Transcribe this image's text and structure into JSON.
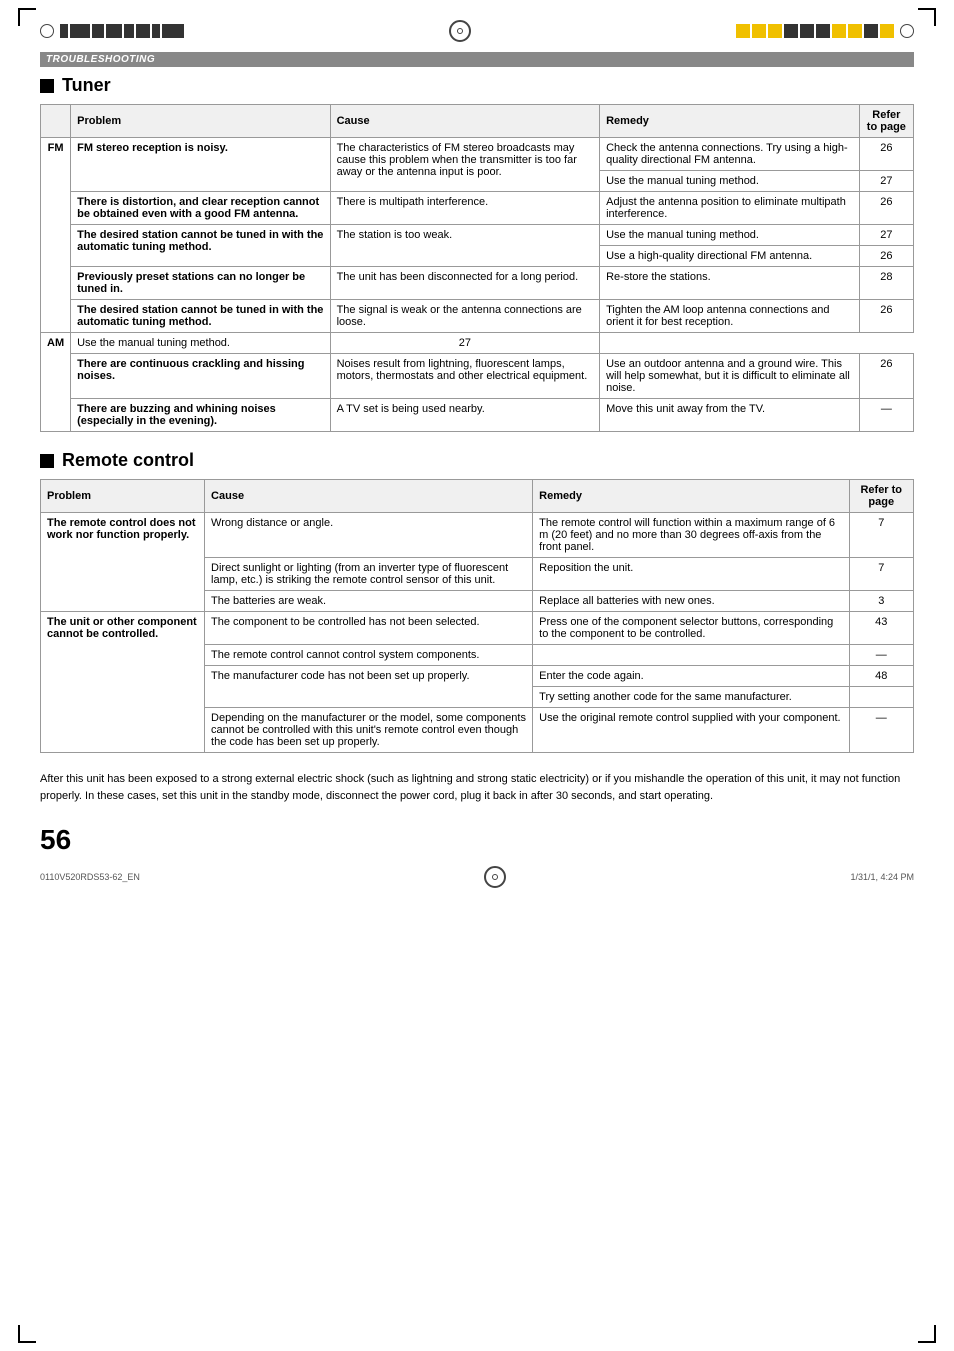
{
  "page": {
    "section_header": "TROUBLESHOOTING",
    "tuner_title": "Tuner",
    "remote_title": "Remote control",
    "page_number": "56",
    "footer_code": "0110V520RDS53-62_EN",
    "footer_page": "56",
    "footer_date": "1/31/1, 4:24 PM"
  },
  "tuner_table": {
    "headers": [
      "Problem",
      "Cause",
      "Remedy",
      "Refer to page"
    ],
    "fm_label": "FM",
    "am_label": "AM",
    "rows": [
      {
        "problem": "FM stereo reception is noisy.",
        "causes": [
          "The characteristics of FM stereo broadcasts may cause this problem when the transmitter is too far away or the antenna input is poor."
        ],
        "remedies": [
          "Check the antenna connections. Try using a high-quality directional FM antenna.",
          "Use the manual tuning method."
        ],
        "refer": [
          "26",
          "27"
        ]
      },
      {
        "problem": "There is distortion, and clear reception cannot be obtained even with a good FM antenna.",
        "causes": [
          "There is multipath interference."
        ],
        "remedies": [
          "Adjust the antenna position to eliminate multipath interference."
        ],
        "refer": [
          "26"
        ]
      },
      {
        "problem": "The desired station cannot be tuned in with the automatic tuning method.",
        "causes": [
          "The station is too weak."
        ],
        "remedies": [
          "Use the manual tuning method.",
          "Use a high-quality directional FM antenna."
        ],
        "refer": [
          "27",
          "26"
        ]
      },
      {
        "problem": "Previously preset stations can no longer be tuned in.",
        "causes": [
          "The unit has been disconnected for a long period."
        ],
        "remedies": [
          "Re-store the stations."
        ],
        "refer": [
          "28"
        ]
      },
      {
        "problem": "The desired station cannot be tuned in with the automatic tuning method.",
        "causes": [
          "The signal is weak or the antenna connections are loose."
        ],
        "remedies": [
          "Tighten the AM loop antenna connections and orient it for best reception.",
          "Use the manual tuning method."
        ],
        "refer": [
          "26",
          "27"
        ],
        "am": true
      },
      {
        "problem": "There are continuous crackling and hissing noises.",
        "causes": [
          "Noises result from lightning, fluorescent lamps, motors, thermostats and other electrical equipment."
        ],
        "remedies": [
          "Use an outdoor antenna and a ground wire. This will help somewhat, but it is difficult to eliminate all noise."
        ],
        "refer": [
          "26"
        ]
      },
      {
        "problem": "There are buzzing and whining noises (especially in the evening).",
        "causes": [
          "A TV set is being used nearby."
        ],
        "remedies": [
          "Move this unit away from the TV."
        ],
        "refer": [
          "—"
        ]
      }
    ]
  },
  "remote_table": {
    "headers": [
      "Problem",
      "Cause",
      "Remedy",
      "Refer to page"
    ],
    "rows": [
      {
        "problem": "The remote control does not work nor function properly.",
        "causes": [
          "Wrong distance or angle.",
          "Direct sunlight or lighting (from an inverter type of fluorescent lamp, etc.) is striking the remote control sensor of this unit.",
          "The batteries are weak."
        ],
        "remedies": [
          "The remote control will function within a maximum range of 6 m (20 feet) and no more than 30 degrees off-axis from the front panel.",
          "Reposition the unit.",
          "Replace all batteries with new ones."
        ],
        "refer": [
          "7",
          "7",
          "3"
        ]
      },
      {
        "problem": "The unit or other component cannot be controlled.",
        "causes": [
          "The component to be controlled has not been selected.",
          "The remote control cannot control system components.",
          "The manufacturer code has not been set up properly.",
          "The manufacturer code has not been set up properly.",
          "Depending on the manufacturer or the model, some components cannot be controlled with this unit's remote control even though the code has been set up properly."
        ],
        "remedies": [
          "Press one of the component selector buttons, corresponding to the component to be controlled.",
          "",
          "Enter the code again.",
          "Try setting another code for the same manufacturer.",
          "Use the original remote control supplied with your component."
        ],
        "refer": [
          "43",
          "—",
          "48",
          "",
          "—"
        ]
      }
    ]
  },
  "footer_note": "After this unit has been exposed to a strong external electric shock (such as lightning and strong static electricity) or if you mishandle the operation of this unit, it may not function properly. In these cases, set this unit in the standby mode, disconnect the power cord, plug it back in after 30 seconds, and start operating."
}
